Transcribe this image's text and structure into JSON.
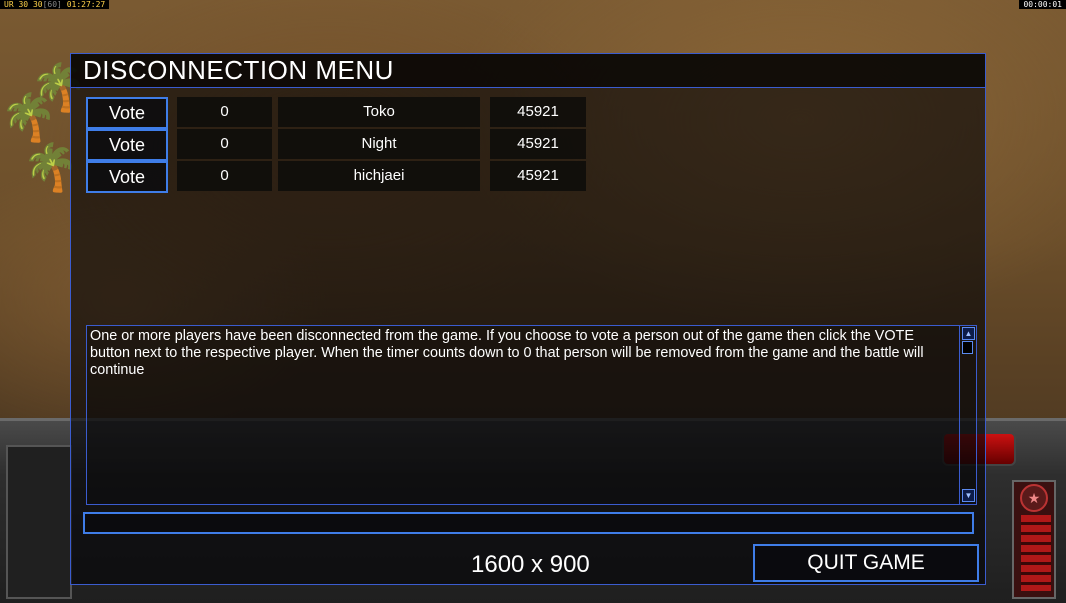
{
  "overlay": {
    "fps_tag": "UR",
    "fps_value": "30",
    "fps_target": "30",
    "fps_limit": "60",
    "clock": "01:27:27",
    "game_timer": "00:00:01"
  },
  "dialog": {
    "title": "DISCONNECTION MENU",
    "players": [
      {
        "vote_label": "Vote",
        "timer": "0",
        "name": "Toko",
        "ping": "45921"
      },
      {
        "vote_label": "Vote",
        "timer": "0",
        "name": "Night",
        "ping": "45921"
      },
      {
        "vote_label": "Vote",
        "timer": "0",
        "name": "hichjaei",
        "ping": "45921"
      }
    ],
    "message": "One or more players have been disconnected from the game. If you choose to vote a person out of the game then click the VOTE button next to the respective player. When the timer counts down to 0 that person will be removed from the game and the battle will continue",
    "chat_value": "",
    "resolution": "1600 x 900",
    "quit_label": "QUIT GAME"
  },
  "hud": {
    "rank_icon": "star-icon",
    "palm_icon": "palm-tree-icon"
  },
  "colors": {
    "accent_border": "#3f7de8",
    "panel_bg": "#0a0a0e",
    "text": "#ffffff"
  }
}
